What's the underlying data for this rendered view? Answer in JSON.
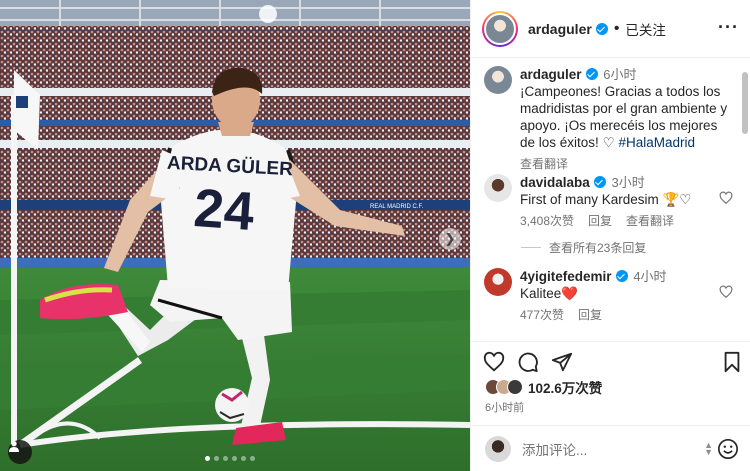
{
  "post": {
    "author": "ardaguler",
    "follow_status": "已关注",
    "caption": {
      "time": "6小时",
      "text": "¡Campeones! Gracias a todos los madridistas por el gran ambiente y apoyo. ¡Os merecéis los mejores de los éxitos!",
      "heart": "♡",
      "hashtag": "#HalaMadrid",
      "translate": "查看翻译"
    },
    "photo": {
      "jersey_name": "ARDA GÜLER",
      "jersey_number": "24",
      "stand_banner": "REAL MADRID C.F."
    },
    "likes": "102.6万次赞",
    "posted_ago": "6小时前"
  },
  "comments": [
    {
      "user": "davidalaba",
      "time": "3小时",
      "text": "First of many Kardesim 🏆♡",
      "likes": "3,408次赞",
      "reply": "回复",
      "translate": "查看翻译",
      "view_replies": "查看所有23条回复"
    },
    {
      "user": "4yigitefedemir",
      "time": "4小时",
      "text": "Kalitee❤️",
      "likes": "477次赞",
      "reply": "回复"
    }
  ],
  "composer": {
    "placeholder": "添加评论..."
  },
  "colors": {
    "verified": "#0095f6",
    "link": "#00376b",
    "secondary": "#737373"
  },
  "icons": [
    "heart-icon",
    "comment-icon",
    "share-icon",
    "bookmark-icon",
    "emoji-icon",
    "more-icon",
    "tag-user-icon",
    "chevron-right-icon"
  ]
}
